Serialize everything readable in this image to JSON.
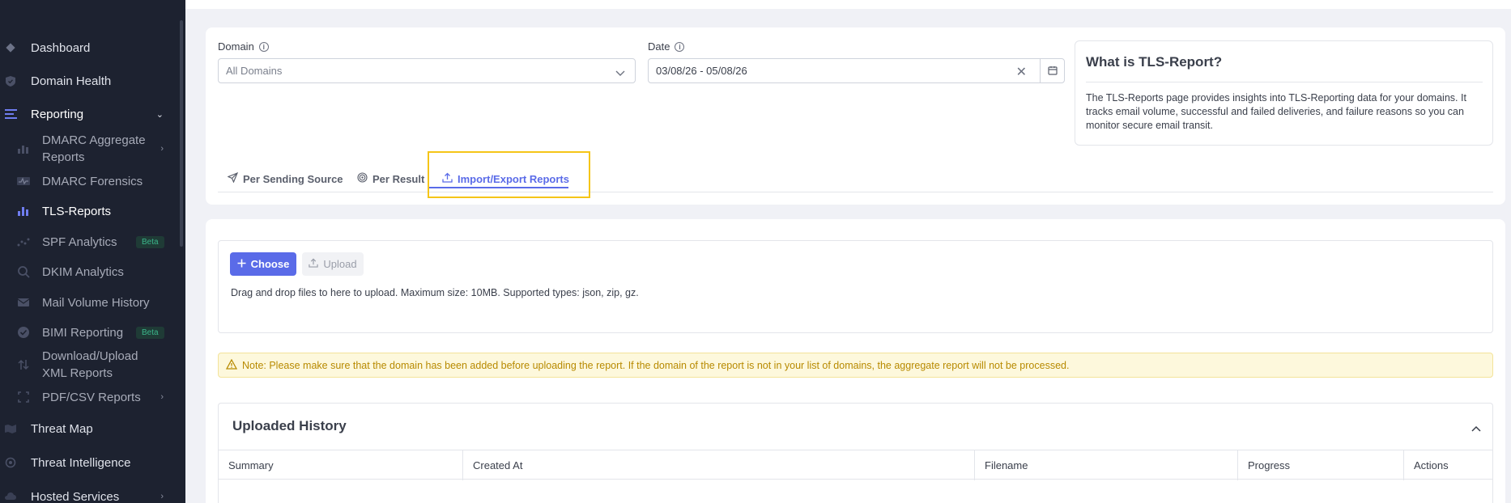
{
  "sidebar": {
    "items": [
      {
        "label": "Dashboard",
        "icon": "diamond-icon"
      },
      {
        "label": "Domain Health",
        "icon": "shield-icon"
      },
      {
        "label": "Reporting",
        "icon": "lines-icon"
      },
      {
        "label": "DMARC Aggregate Reports",
        "icon": "bar-chart-icon"
      },
      {
        "label": "DMARC Forensics",
        "icon": "pulse-icon"
      },
      {
        "label": "TLS-Reports",
        "icon": "bar-chart-icon"
      },
      {
        "label": "SPF Analytics",
        "icon": "scatter-icon",
        "badge": "Beta"
      },
      {
        "label": "DKIM Analytics",
        "icon": "search-icon"
      },
      {
        "label": "Mail Volume History",
        "icon": "mail-icon"
      },
      {
        "label": "BIMI Reporting",
        "icon": "badge-check-icon",
        "badge": "Beta"
      },
      {
        "label": "Download/Upload XML Reports",
        "icon": "up-down-arrows-icon"
      },
      {
        "label": "PDF/CSV Reports",
        "icon": "frame-icon"
      },
      {
        "label": "Threat Map",
        "icon": "map-icon"
      },
      {
        "label": "Threat Intelligence",
        "icon": "target-icon"
      },
      {
        "label": "Hosted Services",
        "icon": "cloud-icon"
      }
    ]
  },
  "filters": {
    "domain_label": "Domain",
    "domain_value": "All Domains",
    "date_label": "Date",
    "date_value": "03/08/26 - 05/08/26"
  },
  "info": {
    "title": "What is TLS-Report?",
    "body": "The TLS-Reports page provides insights into TLS-Reporting data for your domains. It tracks email volume, successful and failed deliveries, and failure reasons so you can monitor secure email transit."
  },
  "tabs": [
    {
      "label": "Per Sending Source",
      "icon": "send-icon"
    },
    {
      "label": "Per Result",
      "icon": "target-icon"
    },
    {
      "label": "Import/Export Reports",
      "icon": "upload-icon",
      "active": true
    }
  ],
  "upload": {
    "choose_label": "Choose",
    "upload_label": "Upload",
    "drop_text": "Drag and drop files to here to upload. Maximum size: 10MB. Supported types: json, zip, gz."
  },
  "note": "Note: Please make sure that the domain has been added before uploading the report. If the domain of the report is not in your list of domains, the aggregate report will not be processed.",
  "history": {
    "title": "Uploaded History",
    "columns": [
      "Summary",
      "Created At",
      "Filename",
      "Progress",
      "Actions"
    ]
  },
  "colors": {
    "accent": "#5a6be8",
    "sidebar_bg": "#1d2230",
    "highlight": "#f5c518",
    "note_text": "#b88a00"
  }
}
